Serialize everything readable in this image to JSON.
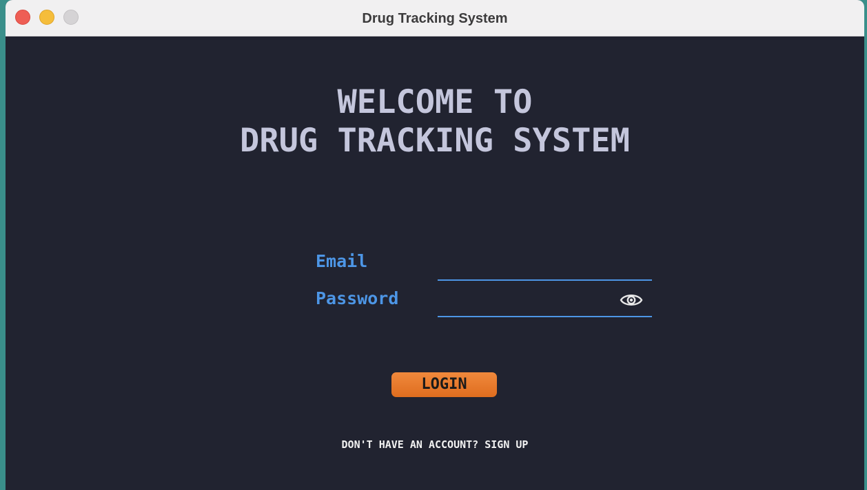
{
  "window": {
    "title": "Drug Tracking System"
  },
  "welcome": {
    "line1": "WELCOME TO",
    "line2": "DRUG TRACKING SYSTEM"
  },
  "form": {
    "email_label": "Email",
    "email_value": "",
    "password_label": "Password",
    "password_value": "",
    "password_toggle_icon": "eye-icon"
  },
  "actions": {
    "login_label": "LOGIN",
    "signup_link": "DON'T HAVE AN ACCOUNT? SIGN UP"
  },
  "colors": {
    "background": "#212330",
    "title_text": "#c4c6dc",
    "accent_blue": "#4d96e6",
    "login_button": "#e97b2c"
  }
}
